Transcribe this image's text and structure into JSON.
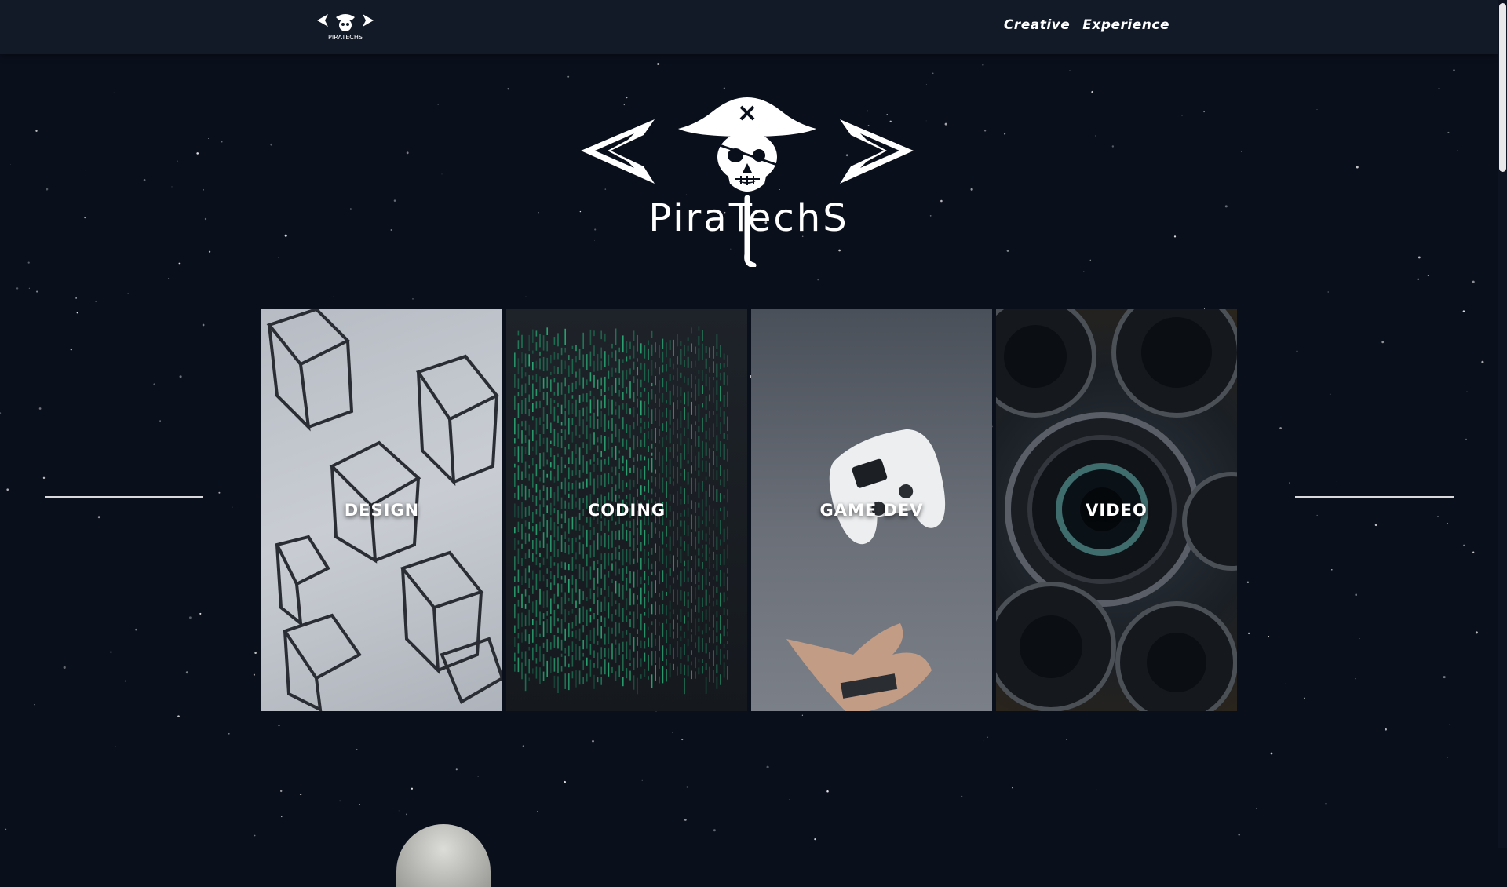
{
  "nav": {
    "items": [
      {
        "label": "Creative"
      },
      {
        "label": "Experience"
      }
    ]
  },
  "hero": {
    "brand_text": "PiraTechS"
  },
  "tiles": [
    {
      "label": "DESIGN"
    },
    {
      "label": "CODING"
    },
    {
      "label": "GAME DEV"
    },
    {
      "label": "VIDEO"
    }
  ],
  "colors": {
    "background": "#0a0f1c",
    "topbar": "#121a27",
    "accent": "#ffffff"
  },
  "icons": [
    "pirate-skull-logo-icon"
  ]
}
